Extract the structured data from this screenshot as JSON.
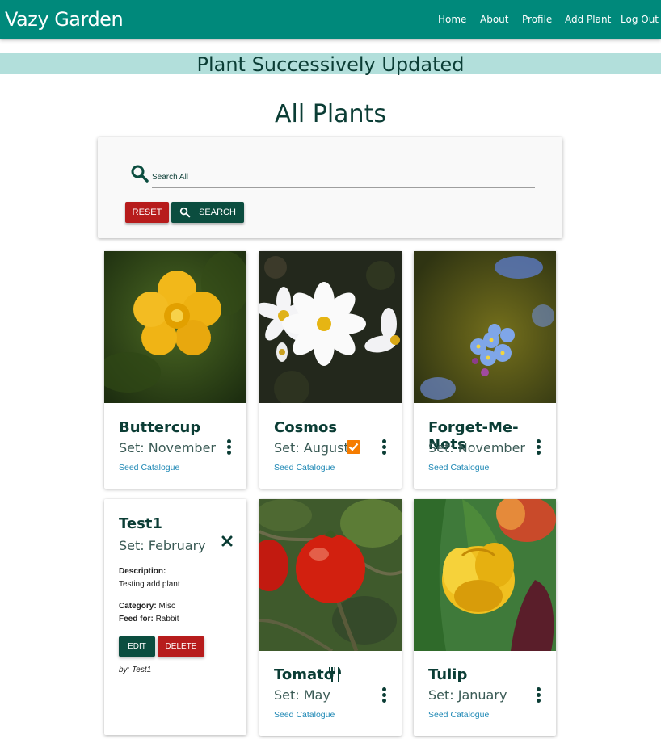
{
  "navbar": {
    "brand": "Vazy Garden",
    "links": [
      "Home",
      "About",
      "Profile",
      "Add Plant",
      "Log Out"
    ],
    "color": "#00897b"
  },
  "flash": {
    "message": "Plant Successively Updated",
    "color": "#b2dfdb"
  },
  "page_title": "All Plants",
  "search": {
    "placeholder": "Search All",
    "reset_label": "RESET",
    "search_label": "SEARCH"
  },
  "plants": [
    {
      "name": "Buttercup",
      "set": "Set: November",
      "link": "Seed Catalogue",
      "badge": null
    },
    {
      "name": "Cosmos",
      "set": "Set: August",
      "link": "Seed Catalogue",
      "badge": "checkbox-icon"
    },
    {
      "name": "Forget-Me-Nots",
      "set": "Set: November",
      "link": "Seed Catalogue",
      "badge": null
    },
    {
      "name": "Test1",
      "set": "Set: February",
      "revealed": true,
      "description_label": "Description:",
      "description": "Testing add plant",
      "category_label": "Category:",
      "category": "Misc",
      "feed_label": "Feed for:",
      "feed": "Rabbit",
      "edit_label": "EDIT",
      "delete_label": "DELETE",
      "by": "by: Test1"
    },
    {
      "name": "Tomato",
      "set": "Set: May",
      "link": "Seed Catalogue",
      "badge": "fork-knife-icon"
    },
    {
      "name": "Tulip",
      "set": "Set: January",
      "link": "Seed Catalogue",
      "badge": null
    }
  ],
  "colors": {
    "primary_dark": "#0b4d3f",
    "danger": "#b71c1c",
    "accent_orange": "#f57c00",
    "link": "#1e88b5"
  }
}
